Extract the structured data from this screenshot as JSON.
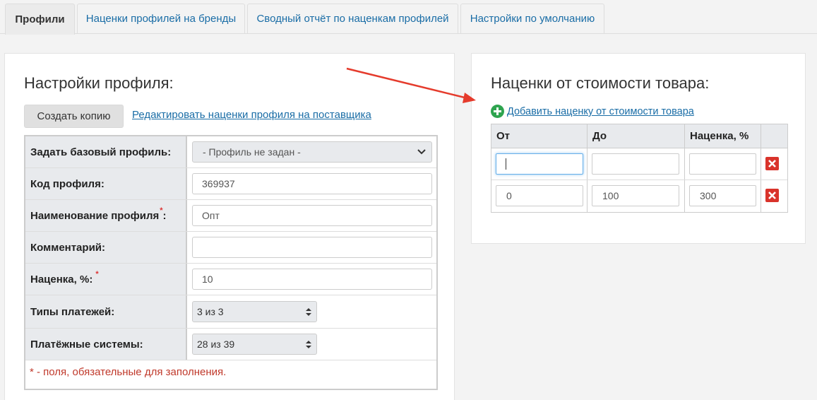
{
  "tabs": [
    {
      "label": "Профили",
      "active": true
    },
    {
      "label": "Наценки профилей на бренды",
      "active": false
    },
    {
      "label": "Сводный отчёт по наценкам профилей",
      "active": false
    },
    {
      "label": "Настройки по умолчанию",
      "active": false
    }
  ],
  "profile_settings": {
    "title": "Настройки профиля:",
    "copy_button": "Создать копию",
    "edit_link": "Редактировать наценки профиля на поставщика",
    "rows": {
      "base_profile": {
        "label": "Задать базовый профиль:",
        "value": "- Профиль не задан -"
      },
      "code": {
        "label": "Код профиля:",
        "value": "369937"
      },
      "name": {
        "label": "Наименование профиля",
        "required_mark": "*",
        "suffix": ":",
        "value": "Опт"
      },
      "comment": {
        "label": "Комментарий:",
        "value": ""
      },
      "markup": {
        "label": "Наценка, %:",
        "required_mark": "*",
        "value": "10"
      },
      "payment_types": {
        "label": "Типы платежей:",
        "value": "3 из 3"
      },
      "payment_systems": {
        "label": "Платёжные системы:",
        "value": "28 из 39"
      }
    },
    "footnote": "* - поля, обязательные для заполнения."
  },
  "cost_markups": {
    "title": "Наценки от стоимости товара:",
    "add_link": "Добавить наценку от стоимости товара",
    "columns": [
      "От",
      "До",
      "Наценка, %"
    ],
    "rows": [
      {
        "from": "",
        "to": "",
        "markup": ""
      },
      {
        "from": "0",
        "to": "100",
        "markup": "300"
      }
    ]
  },
  "colors": {
    "accent_link": "#1a6da6",
    "delete": "#d9332b",
    "add": "#2ea44f",
    "arrow": "#e53b2c"
  }
}
